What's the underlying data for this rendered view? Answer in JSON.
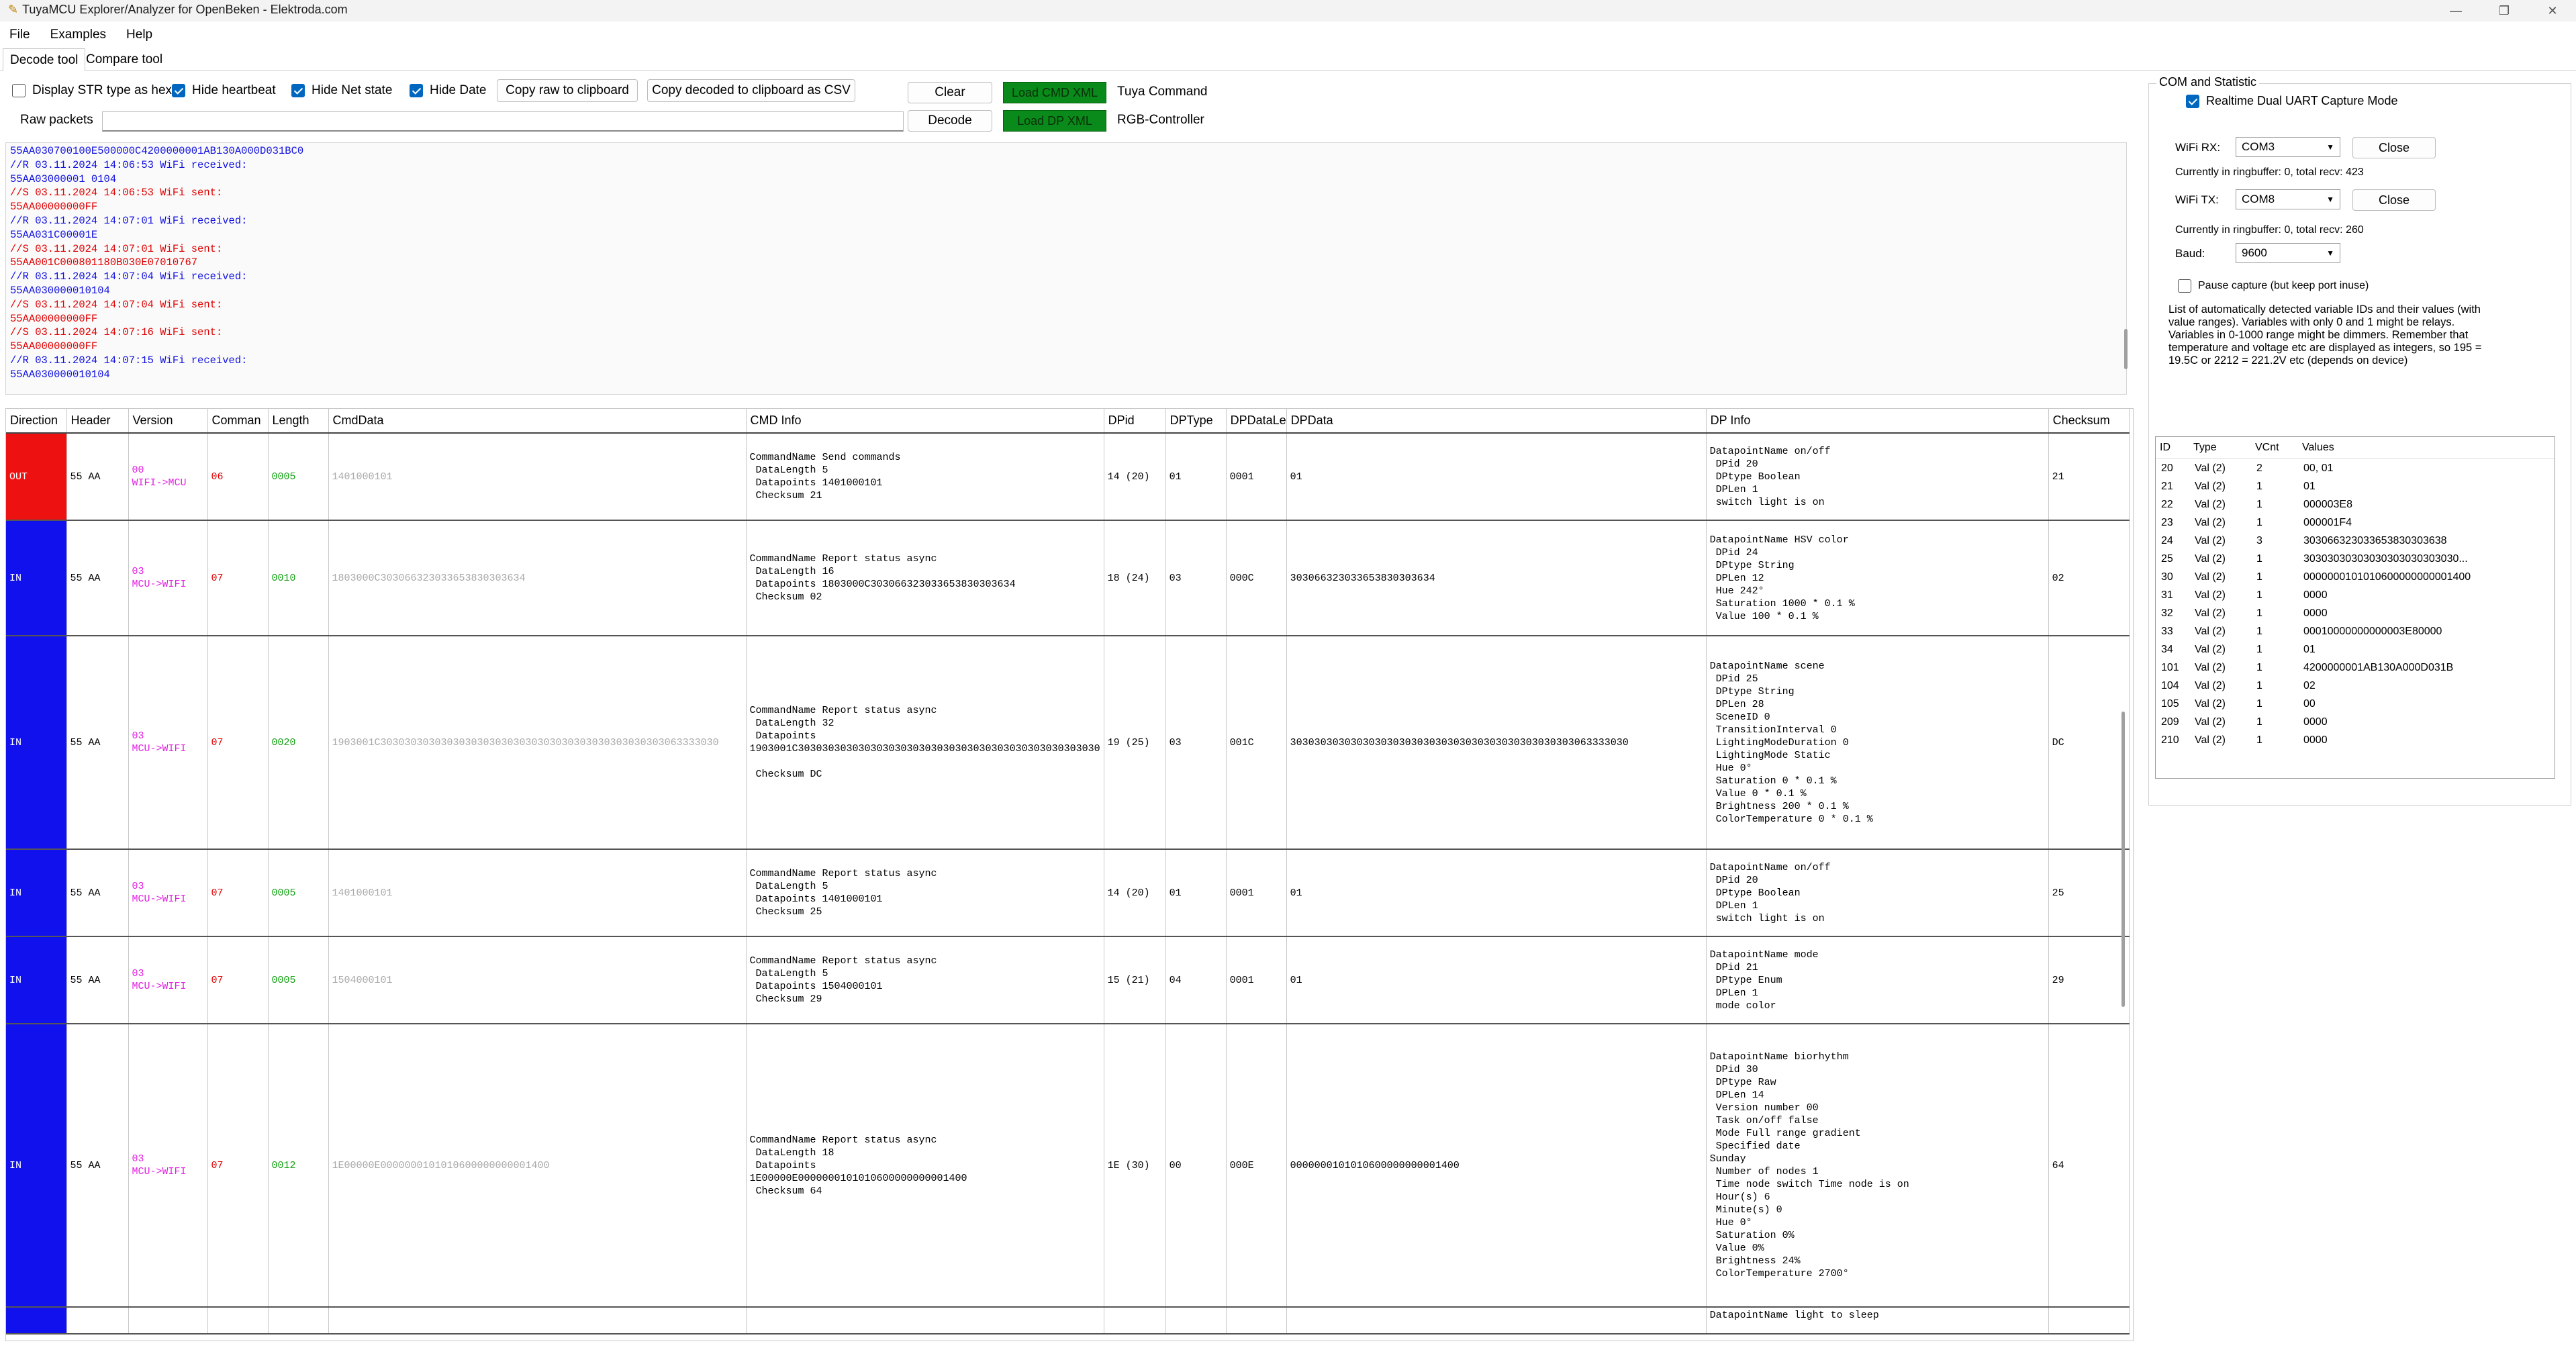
{
  "window": {
    "title": "TuyaMCU Explorer/Analyzer for OpenBeken - Elektroda.com"
  },
  "menu": [
    "File",
    "Examples",
    "Help"
  ],
  "tabs": [
    "Decode tool",
    "Compare tool"
  ],
  "toolbar": {
    "display_str_hex": {
      "label": "Display STR type as hex",
      "checked": false
    },
    "hide_heartbeat": {
      "label": "Hide heartbeat",
      "checked": true
    },
    "hide_net_state": {
      "label": "Hide Net state",
      "checked": true
    },
    "hide_date": {
      "label": "Hide Date",
      "checked": true
    },
    "copy_raw": "Copy raw to clipboard",
    "copy_decoded": "Copy decoded to clipboard as CSV",
    "clear": "Clear",
    "decode": "Decode",
    "load_cmd_xml": "Load CMD XML",
    "load_dp_xml": "Load DP XML",
    "cmd_xml_name": "Tuya Command",
    "dp_xml_name": "RGB-Controller",
    "raw_packets_label": "Raw packets",
    "raw_packets_value": ""
  },
  "log": [
    {
      "t": "55AA030700100E500000C4200000001AB130A000D031BC0",
      "c": "blue"
    },
    {
      "t": "//R 03.11.2024 14:06:53 WiFi received:",
      "c": "blue"
    },
    {
      "t": "55AA03000001 0104",
      "c": "blue"
    },
    {
      "t": "//S 03.11.2024 14:06:53 WiFi sent:",
      "c": "red"
    },
    {
      "t": "55AA00000000FF",
      "c": "red"
    },
    {
      "t": "//R 03.11.2024 14:07:01 WiFi received:",
      "c": "blue"
    },
    {
      "t": "55AA031C00001E",
      "c": "blue"
    },
    {
      "t": "//S 03.11.2024 14:07:01 WiFi sent:",
      "c": "red"
    },
    {
      "t": "55AA001C000801180B030E07010767",
      "c": "red"
    },
    {
      "t": "//R 03.11.2024 14:07:04 WiFi received:",
      "c": "blue"
    },
    {
      "t": "55AA030000010104",
      "c": "blue"
    },
    {
      "t": "//S 03.11.2024 14:07:04 WiFi sent:",
      "c": "red"
    },
    {
      "t": "55AA00000000FF",
      "c": "red"
    },
    {
      "t": "//S 03.11.2024 14:07:16 WiFi sent:",
      "c": "red"
    },
    {
      "t": "55AA00000000FF",
      "c": "red"
    },
    {
      "t": "//R 03.11.2024 14:07:15 WiFi received:",
      "c": "blue"
    },
    {
      "t": "55AA030000010104",
      "c": "blue"
    }
  ],
  "table": {
    "headers": [
      "Direction",
      "Header",
      "Version",
      "Comman",
      "Length",
      "CmdData",
      "CMD Info",
      "DPid",
      "DPType",
      "DPDataLe",
      "DPData",
      "DP Info",
      "Checksum"
    ],
    "rows": [
      {
        "dir": "OUT",
        "color": "#ee1111",
        "header": "55 AA",
        "version": "00\nWIFI->MCU",
        "cmd": "06",
        "len": "0005",
        "cmddata": "1401000101",
        "cmdinfo": "CommandName Send commands\n DataLength 5\n Datapoints 1401000101\n Checksum 21",
        "dpid": "14 (20)",
        "dptype": "01",
        "dplen": "0001",
        "dpdata": "01",
        "dpinfo": "DatapointName on/off\n DPid 20\n DPtype Boolean\n DPLen 1\n switch light is on",
        "checksum": "21"
      },
      {
        "dir": "IN",
        "color": "#1111ee",
        "header": "55 AA",
        "version": "03\nMCU->WIFI",
        "cmd": "07",
        "len": "0010",
        "cmddata": "1803000C303066323033653830303634",
        "cmdinfo": "CommandName Report status async\n DataLength 16\n Datapoints 1803000C303066323033653830303634\n Checksum 02",
        "dpid": "18 (24)",
        "dptype": "03",
        "dplen": "000C",
        "dpdata": "303066323033653830303634",
        "dpinfo": "DatapointName HSV color\n DPid 24\n DPtype String\n DPLen 12\n Hue 242°\n Saturation 1000 * 0.1 %\n Value 100 * 0.1 %",
        "checksum": "02"
      },
      {
        "dir": "IN",
        "color": "#1111ee",
        "header": "55 AA",
        "version": "03\nMCU->WIFI",
        "cmd": "07",
        "len": "0020",
        "cmddata": "1903001C30303030303030303030303030303030303030303030303063333030",
        "cmdinfo": "CommandName Report status async\n DataLength 32\n Datapoints\n1903001C30303030303030303030303030303030303030303030303030\n\n Checksum DC",
        "dpid": "19 (25)",
        "dptype": "03",
        "dplen": "001C",
        "dpdata": "30303030303030303030303030303030303030303030303063333030",
        "dpinfo": "DatapointName scene\n DPid 25\n DPtype String\n DPLen 28\n SceneID 0\n TransitionInterval 0\n LightingModeDuration 0\n LightingMode Static\n Hue 0°\n Saturation 0 * 0.1 %\n Value 0 * 0.1 %\n Brightness 200 * 0.1 %\n ColorTemperature 0 * 0.1 %",
        "checksum": "DC"
      },
      {
        "dir": "IN",
        "color": "#1111ee",
        "header": "55 AA",
        "version": "03\nMCU->WIFI",
        "cmd": "07",
        "len": "0005",
        "cmddata": "1401000101",
        "cmdinfo": "CommandName Report status async\n DataLength 5\n Datapoints 1401000101\n Checksum 25",
        "dpid": "14 (20)",
        "dptype": "01",
        "dplen": "0001",
        "dpdata": "01",
        "dpinfo": "DatapointName on/off\n DPid 20\n DPtype Boolean\n DPLen 1\n switch light is on",
        "checksum": "25"
      },
      {
        "dir": "IN",
        "color": "#1111ee",
        "header": "55 AA",
        "version": "03\nMCU->WIFI",
        "cmd": "07",
        "len": "0005",
        "cmddata": "1504000101",
        "cmdinfo": "CommandName Report status async\n DataLength 5\n Datapoints 1504000101\n Checksum 29",
        "dpid": "15 (21)",
        "dptype": "04",
        "dplen": "0001",
        "dpdata": "01",
        "dpinfo": "DatapointName mode\n DPid 21\n DPtype Enum\n DPLen 1\n mode color",
        "checksum": "29"
      },
      {
        "dir": "IN",
        "color": "#1111ee",
        "header": "55 AA",
        "version": "03\nMCU->WIFI",
        "cmd": "07",
        "len": "0012",
        "cmddata": "1E00000E0000000101010600000000001400",
        "cmdinfo": "CommandName Report status async\n DataLength 18\n Datapoints\n1E00000E0000000101010600000000001400\n Checksum 64",
        "dpid": "1E (30)",
        "dptype": "00",
        "dplen": "000E",
        "dpdata": "0000000101010600000000001400",
        "dpinfo": "DatapointName biorhythm\n DPid 30\n DPtype Raw\n DPLen 14\n Version number 00\n Task on/off false\n Mode Full range gradient\n Specified date\nSunday\n Number of nodes 1\n Time node switch Time node is on\n Hour(s) 6\n Minute(s) 0\n Hue 0°\n Saturation 0%\n Value 0%\n Brightness 24%\n ColorTemperature 2700°",
        "checksum": "64"
      },
      {
        "dir": "",
        "color": "#1111ee",
        "header": "",
        "version": "",
        "cmd": "",
        "len": "",
        "cmddata": "",
        "cmdinfo": "",
        "dpid": "",
        "dptype": "",
        "dplen": "",
        "dpdata": "",
        "dpinfo": "DatapointName light to sleep",
        "checksum": ""
      }
    ]
  },
  "com": {
    "group_title": "COM and Statistic",
    "realtime": {
      "label": "Realtime Dual UART Capture Mode",
      "checked": true
    },
    "wifi_rx_label": "WiFi RX:",
    "wifi_rx_value": "COM3",
    "wifi_tx_label": "WiFi TX:",
    "wifi_tx_value": "COM8",
    "close_label": "Close",
    "rx_stats": "Currently in ringbuffer: 0, total recv: 423",
    "tx_stats": "Currently in ringbuffer: 0, total recv: 260",
    "baud_label": "Baud:",
    "baud_value": "9600",
    "pause": {
      "label": "Pause capture (but keep port inuse)",
      "checked": false
    },
    "info": "List of automatically detected variable IDs  and their values (with value ranges). Variables with only 0 and 1 might be relays. Variables in 0-1000 range might be dimmers. Remember that temperature and voltage etc are displayed as integers, so 195 = 19.5C or 2212 = 221.2V etc (depends on device)"
  },
  "ids": {
    "headers": [
      "ID",
      "Type",
      "VCnt",
      "Values"
    ],
    "rows": [
      [
        "20",
        "Val (2)",
        "2",
        "00, 01"
      ],
      [
        "21",
        "Val (2)",
        "1",
        "01"
      ],
      [
        "22",
        "Val (2)",
        "1",
        "000003E8"
      ],
      [
        "23",
        "Val (2)",
        "1",
        "000001F4"
      ],
      [
        "24",
        "Val (2)",
        "3",
        "303066323033653830303638"
      ],
      [
        "25",
        "Val (2)",
        "1",
        "30303030303030303030303030..."
      ],
      [
        "30",
        "Val (2)",
        "1",
        "0000000101010600000000001400"
      ],
      [
        "31",
        "Val (2)",
        "1",
        "0000"
      ],
      [
        "32",
        "Val (2)",
        "1",
        "0000"
      ],
      [
        "33",
        "Val (2)",
        "1",
        "00010000000000003E80000"
      ],
      [
        "34",
        "Val (2)",
        "1",
        "01"
      ],
      [
        "101",
        "Val (2)",
        "1",
        "4200000001AB130A000D031B"
      ],
      [
        "104",
        "Val (2)",
        "1",
        "02"
      ],
      [
        "105",
        "Val (2)",
        "1",
        "00"
      ],
      [
        "209",
        "Val (2)",
        "1",
        "0000"
      ],
      [
        "210",
        "Val (2)",
        "1",
        "0000"
      ]
    ]
  }
}
